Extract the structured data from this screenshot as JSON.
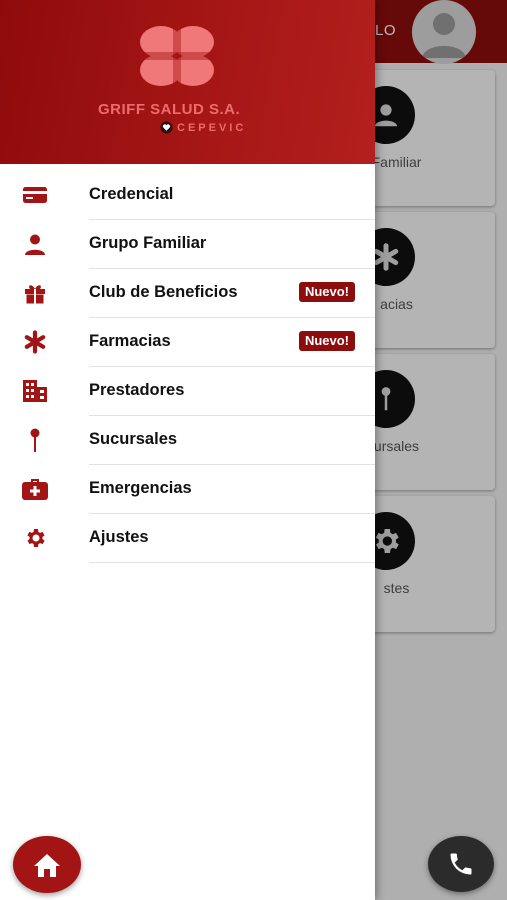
{
  "app": {
    "brand_name": "GRIFF SALUD S.A.",
    "brand_sub": "CEPEVIC",
    "header_title_partial": "LO"
  },
  "menu": {
    "items": [
      {
        "label": "Credencial",
        "icon": "card-icon"
      },
      {
        "label": "Grupo Familiar",
        "icon": "person-icon"
      },
      {
        "label": "Club de Beneficios",
        "icon": "gift-icon",
        "badge": "Nuevo!"
      },
      {
        "label": "Farmacias",
        "icon": "asterisk-icon",
        "badge": "Nuevo!"
      },
      {
        "label": "Prestadores",
        "icon": "building-icon"
      },
      {
        "label": "Sucursales",
        "icon": "location-pin-icon"
      },
      {
        "label": "Emergencias",
        "icon": "medical-kit-icon"
      },
      {
        "label": "Ajustes",
        "icon": "gear-icon"
      }
    ]
  },
  "background_cards": [
    {
      "label": "Familiar",
      "icon": "person-icon"
    },
    {
      "label": "acias",
      "icon": "asterisk-icon"
    },
    {
      "label": "ursales",
      "icon": "location-pin-icon"
    },
    {
      "label": "stes",
      "icon": "gear-icon"
    }
  ],
  "colors": {
    "primary": "#8c0d0d",
    "accent": "#a31515",
    "badge_bg": "#8c0d0d",
    "dark_fab": "#2b2b2b"
  }
}
